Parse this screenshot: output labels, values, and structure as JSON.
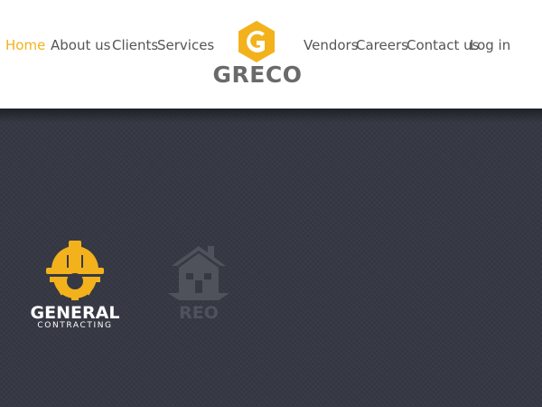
{
  "nav": {
    "left": [
      {
        "label": "Home",
        "active": true
      },
      {
        "label": "About us"
      },
      {
        "label": "Clients"
      },
      {
        "label": "Services"
      }
    ],
    "right": [
      {
        "label": "Vendors"
      },
      {
        "label": "Careers"
      },
      {
        "label": "Contact us"
      },
      {
        "label": "Log in"
      }
    ]
  },
  "logo": {
    "text": "GRECO",
    "icon": "greco-g-gear-icon"
  },
  "colors": {
    "accent": "#f3b21c",
    "nav_text": "#555555",
    "hero_bg": "#363944",
    "logo_text": "#6a6a6a",
    "muted_icon": "#4f525b"
  },
  "services": [
    {
      "title": "GENERAL",
      "subtitle": "CONTRACTING",
      "icon": "hardhat-gear-icon",
      "color": "#f3b21c"
    },
    {
      "title": "REO",
      "subtitle": "",
      "icon": "house-icon",
      "color": "#4f525b"
    }
  ]
}
